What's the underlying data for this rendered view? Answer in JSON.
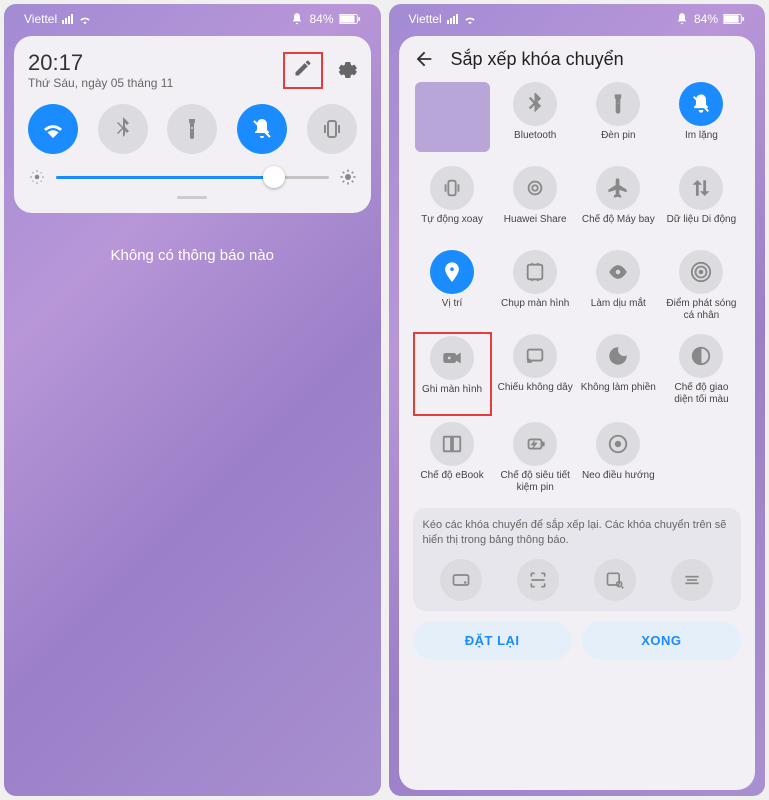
{
  "statusBar": {
    "carrier": "Viettel",
    "battery": "84%"
  },
  "left": {
    "time": "20:17",
    "date": "Thứ Sáu, ngày 05 tháng 11",
    "noNotif": "Không có thông báo nào"
  },
  "right": {
    "title": "Sắp xếp khóa chuyển",
    "tiles": [
      {
        "label": "",
        "isPlaceholder": true
      },
      {
        "label": "Bluetooth",
        "icon": "bluetooth"
      },
      {
        "label": "Đèn pin",
        "icon": "flashlight"
      },
      {
        "label": "Im lặng",
        "icon": "silent",
        "active": true
      },
      {
        "label": "Tự động xoay",
        "icon": "rotate"
      },
      {
        "label": "Huawei Share",
        "icon": "share"
      },
      {
        "label": "Chế độ Máy bay",
        "icon": "airplane"
      },
      {
        "label": "Dữ liệu Di động",
        "icon": "data"
      },
      {
        "label": "Vị trí",
        "icon": "location",
        "active": true
      },
      {
        "label": "Chụp màn hình",
        "icon": "screenshot"
      },
      {
        "label": "Làm dịu mắt",
        "icon": "eye"
      },
      {
        "label": "Điểm phát sóng cá nhân",
        "icon": "hotspot"
      },
      {
        "label": "Ghi màn hình",
        "icon": "record",
        "highlight": true
      },
      {
        "label": "Chiếu không dây",
        "icon": "cast"
      },
      {
        "label": "Không làm phiền",
        "icon": "dnd"
      },
      {
        "label": "Chế độ giao diện tối màu",
        "icon": "dark"
      },
      {
        "label": "Chế độ eBook",
        "icon": "ebook"
      },
      {
        "label": "Chế độ siêu tiết kiệm pin",
        "icon": "battery"
      },
      {
        "label": "Neo điều hướng",
        "icon": "nav"
      }
    ],
    "hint": "Kéo các khóa chuyển để sắp xếp lại. Các khóa chuyển trên sẽ hiển thị trong bảng thông báo.",
    "reset": "ĐẶT LẠI",
    "done": "XONG"
  }
}
